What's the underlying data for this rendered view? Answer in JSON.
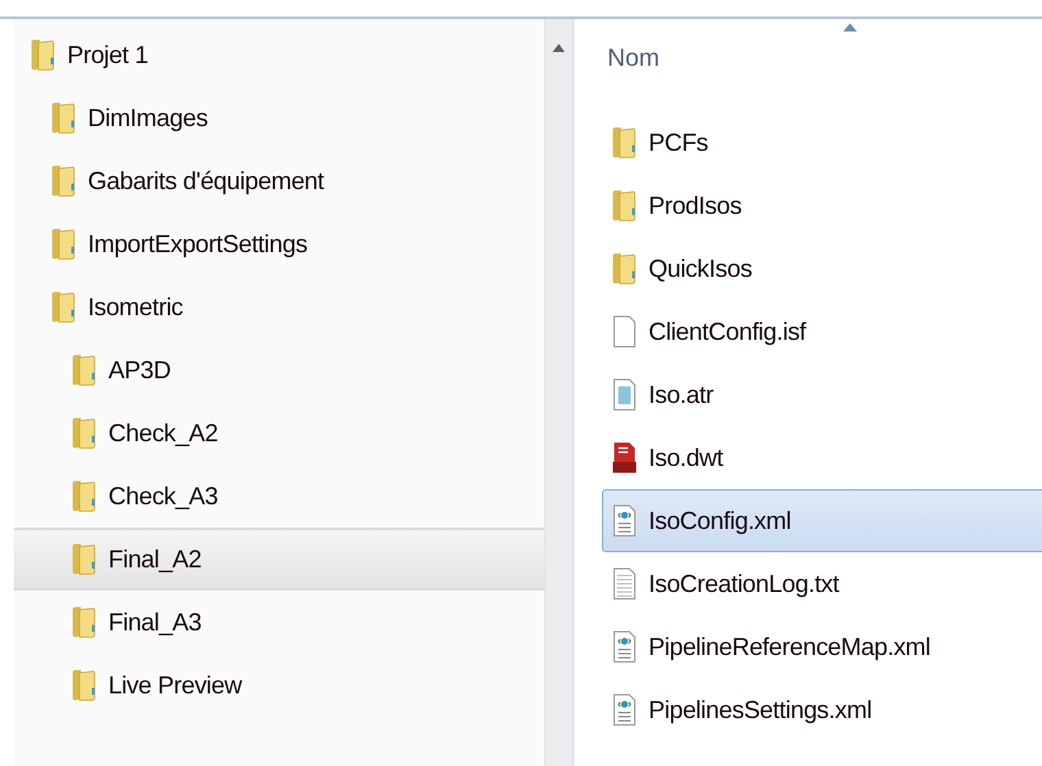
{
  "tree": [
    {
      "label": "Projet 1",
      "selected": false,
      "children": [
        {
          "label": "DimImages",
          "selected": false
        },
        {
          "label": "Gabarits d'équipement",
          "selected": false
        },
        {
          "label": "ImportExportSettings",
          "selected": false
        },
        {
          "label": "Isometric",
          "selected": false,
          "children": [
            {
              "label": "AP3D",
              "selected": false
            },
            {
              "label": "Check_A2",
              "selected": false
            },
            {
              "label": "Check_A3",
              "selected": false
            },
            {
              "label": "Final_A2",
              "selected": true
            },
            {
              "label": "Final_A3",
              "selected": false
            },
            {
              "label": "Live Preview",
              "selected": false
            }
          ]
        }
      ]
    }
  ],
  "file_list": {
    "column_header": "Nom",
    "files": [
      {
        "name": "PCFs",
        "kind": "folder",
        "selected": false
      },
      {
        "name": "ProdIsos",
        "kind": "folder",
        "selected": false
      },
      {
        "name": "QuickIsos",
        "kind": "folder",
        "selected": false
      },
      {
        "name": "ClientConfig.isf",
        "kind": "blank",
        "selected": false
      },
      {
        "name": "Iso.atr",
        "kind": "atr",
        "selected": false
      },
      {
        "name": "Iso.dwt",
        "kind": "dwt",
        "selected": false
      },
      {
        "name": "IsoConfig.xml",
        "kind": "xml",
        "selected": true
      },
      {
        "name": "IsoCreationLog.txt",
        "kind": "txt",
        "selected": false
      },
      {
        "name": "PipelineReferenceMap.xml",
        "kind": "xml",
        "selected": false
      },
      {
        "name": "PipelinesSettings.xml",
        "kind": "xml",
        "selected": false
      }
    ]
  }
}
